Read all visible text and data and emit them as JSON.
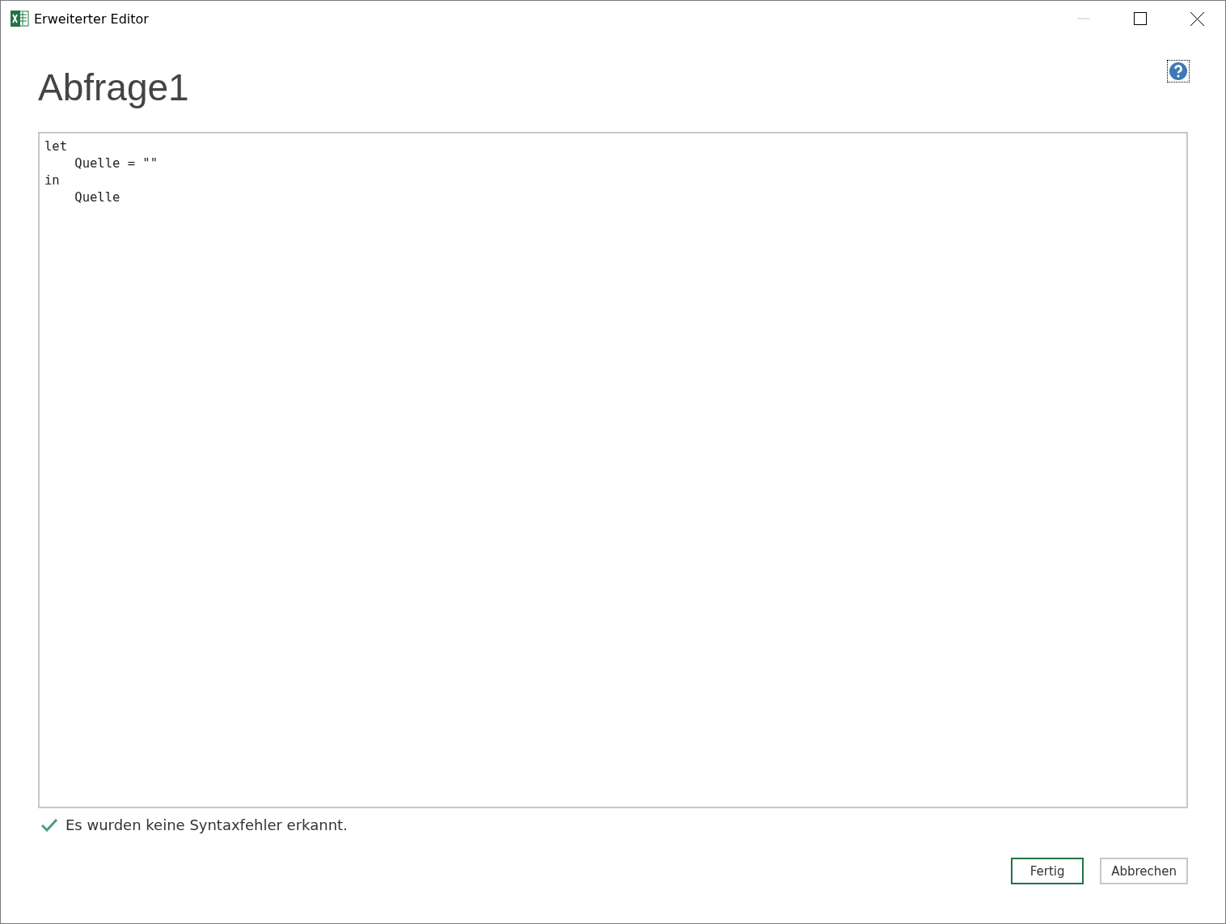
{
  "window": {
    "title": "Erweiterter Editor",
    "minimize_disabled": true
  },
  "query": {
    "title": "Abfrage1"
  },
  "editor": {
    "lines": [
      "let",
      "    Quelle = \"\"",
      "in",
      "    Quelle"
    ]
  },
  "status": {
    "kind": "ok",
    "message": "Es wurden keine Syntaxfehler erkannt."
  },
  "buttons": [
    {
      "label": "Fertig",
      "default": true
    },
    {
      "label": "Abbrechen",
      "default": false
    }
  ]
}
